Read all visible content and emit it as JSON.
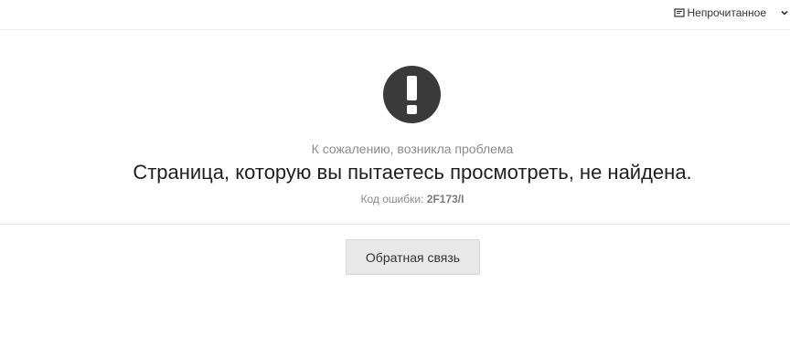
{
  "header": {
    "unread_label": "Непрочитанное",
    "unread_icon": "mail-icon",
    "dropdown_icon": "chevron-down-icon"
  },
  "error": {
    "icon": "exclamation-icon",
    "icon_color": "#3a3a3a",
    "subtitle": "К сожалению, возникла проблема",
    "message": "Страница, которую вы пытаетесь просмотреть, не найдена.",
    "code_label": "Код ошибки:",
    "code_value": "2F173/I"
  },
  "actions": {
    "feedback_label": "Обратная связь"
  }
}
